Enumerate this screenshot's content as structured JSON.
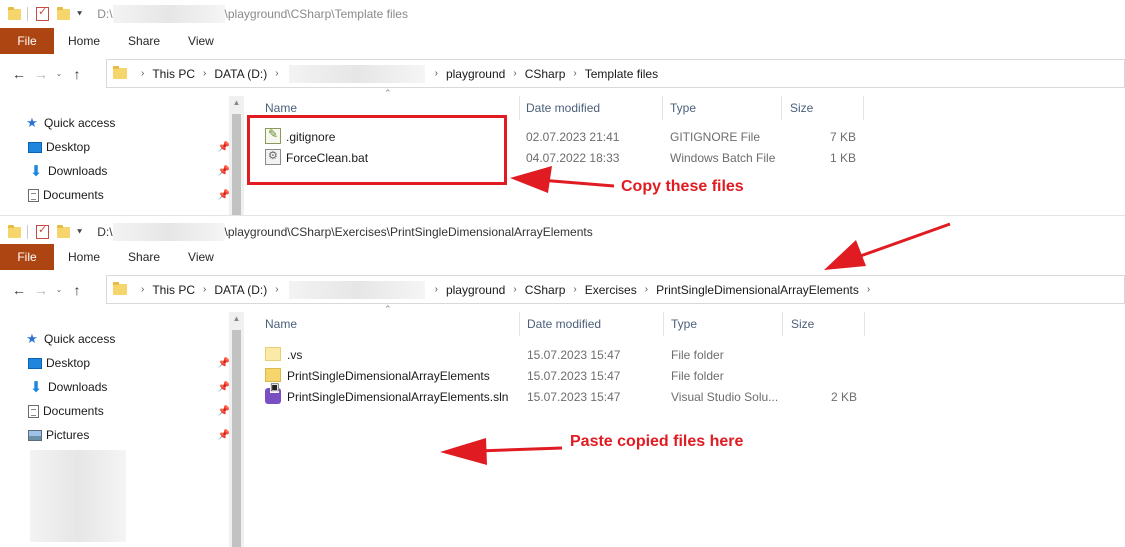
{
  "top_window": {
    "title_prefix": "D:\\",
    "title_suffix": "\\playground\\CSharp\\Template files",
    "ribbon": {
      "file": "File",
      "home": "Home",
      "share": "Share",
      "view": "View"
    },
    "breadcrumbs": [
      "This PC",
      "DATA (D:)",
      "playground",
      "CSharp",
      "Template files"
    ],
    "sidebar": [
      {
        "label": "Quick access",
        "icon": "star-icon"
      },
      {
        "label": "Desktop",
        "icon": "desktop-icon",
        "pinned": true
      },
      {
        "label": "Downloads",
        "icon": "download-icon",
        "pinned": true
      },
      {
        "label": "Documents",
        "icon": "documents-icon",
        "pinned": true
      }
    ],
    "columns": {
      "name": "Name",
      "date": "Date modified",
      "type": "Type",
      "size": "Size"
    },
    "files": [
      {
        "name": ".gitignore",
        "date": "02.07.2023 21:41",
        "type": "GITIGNORE File",
        "size": "7 KB",
        "icon": "gitignore-file-icon"
      },
      {
        "name": "ForceClean.bat",
        "date": "04.07.2022 18:33",
        "type": "Windows Batch File",
        "size": "1 KB",
        "icon": "batch-file-icon"
      }
    ]
  },
  "bottom_window": {
    "title_prefix": "D:\\",
    "title_suffix": "\\playground\\CSharp\\Exercises\\PrintSingleDimensionalArrayElements",
    "ribbon": {
      "file": "File",
      "home": "Home",
      "share": "Share",
      "view": "View"
    },
    "breadcrumbs": [
      "This PC",
      "DATA (D:)",
      "playground",
      "CSharp",
      "Exercises",
      "PrintSingleDimensionalArrayElements"
    ],
    "sidebar": [
      {
        "label": "Quick access",
        "icon": "star-icon"
      },
      {
        "label": "Desktop",
        "icon": "desktop-icon",
        "pinned": true
      },
      {
        "label": "Downloads",
        "icon": "download-icon",
        "pinned": true
      },
      {
        "label": "Documents",
        "icon": "documents-icon",
        "pinned": true
      },
      {
        "label": "Pictures",
        "icon": "pictures-icon",
        "pinned": true
      }
    ],
    "columns": {
      "name": "Name",
      "date": "Date modified",
      "type": "Type",
      "size": "Size"
    },
    "files": [
      {
        "name": ".vs",
        "date": "15.07.2023 15:47",
        "type": "File folder",
        "size": "",
        "icon": "hidden-folder-icon"
      },
      {
        "name": "PrintSingleDimensionalArrayElements",
        "date": "15.07.2023 15:47",
        "type": "File folder",
        "size": "",
        "icon": "folder-icon"
      },
      {
        "name": "PrintSingleDimensionalArrayElements.sln",
        "date": "15.07.2023 15:47",
        "type": "Visual Studio Solu...",
        "size": "2 KB",
        "icon": "visual-studio-solution-icon"
      }
    ]
  },
  "annotations": {
    "copy": "Copy these files",
    "paste": "Paste copied files here",
    "color": "#e01b22"
  }
}
